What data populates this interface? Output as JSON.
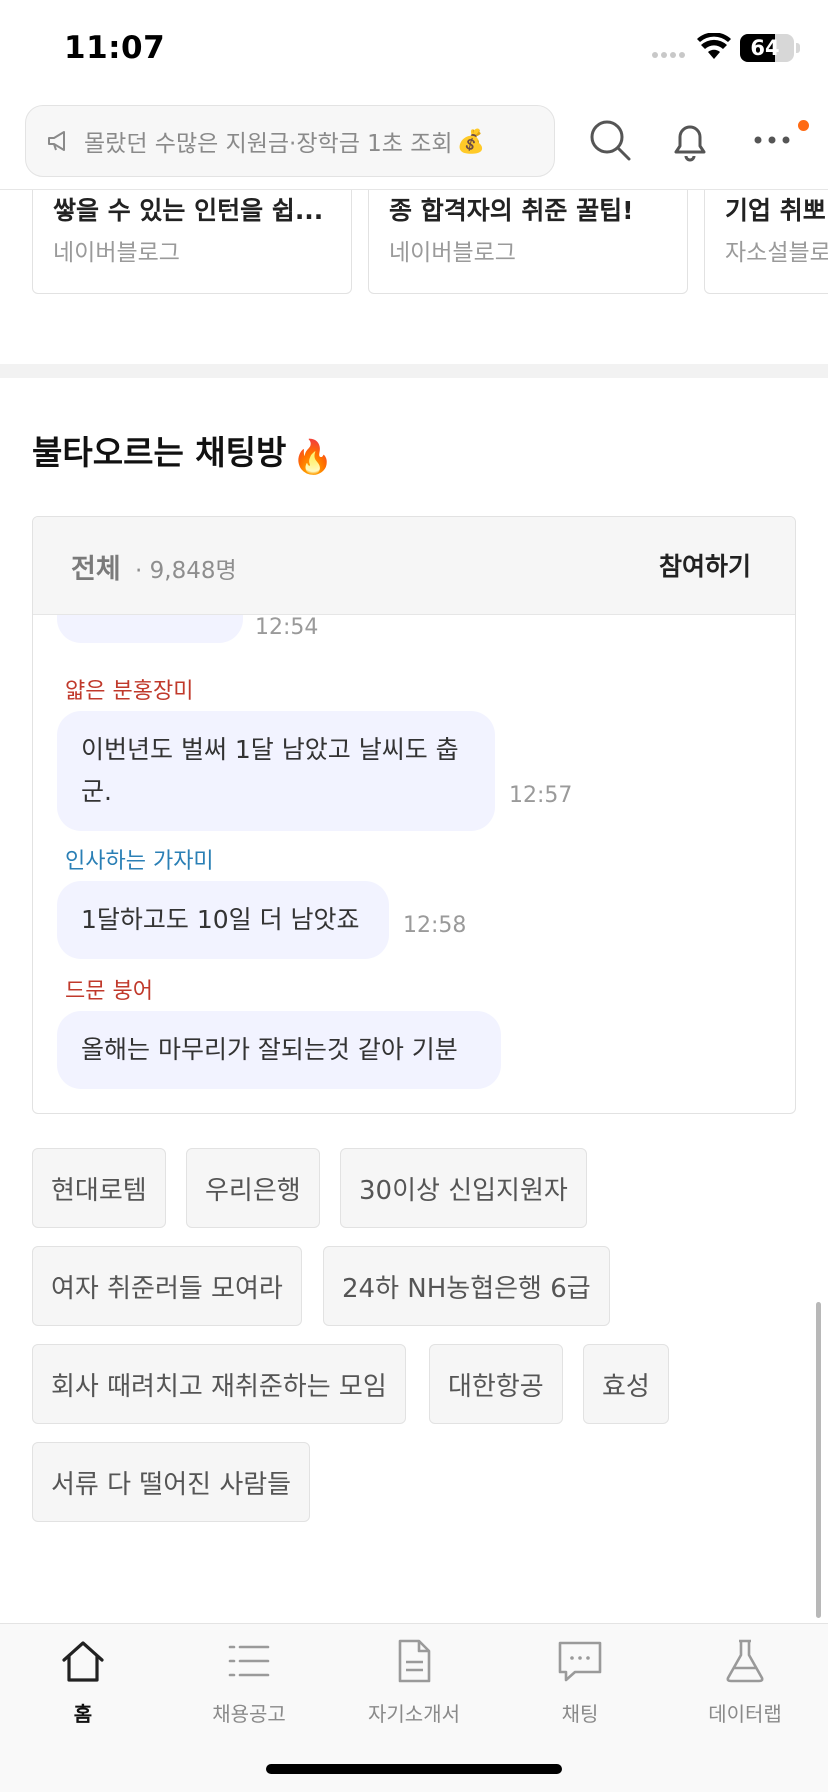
{
  "status": {
    "time": "11:07",
    "battery": "64",
    "battery_level": 0.64
  },
  "header": {
    "search_placeholder": "몰랐던 수많은 지원금·장학금 1초 조회",
    "search_emoji": "💰"
  },
  "blog_cards": [
    {
      "title": "쌓을 수 있는 인턴을 쉽...",
      "source": "네이버블로그"
    },
    {
      "title": "종 합격자의 취준 꿀팁!",
      "source": "네이버블로그"
    },
    {
      "title": "기업 취뽀",
      "source": "자소설블로"
    }
  ],
  "chat_section": {
    "title": "불타오르는 채팅방",
    "title_emoji": "🔥",
    "filter_label": "전체",
    "member_count": "· 9,848명",
    "join_label": "참여하기",
    "messages": [
      {
        "nickname": "",
        "text": "",
        "time": "12:54"
      },
      {
        "nickname": "얇은 분홍장미",
        "nickname_color": "#c0392b",
        "text": "이번년도 벌써 1달 남았고 날씨도 춥군.",
        "time": "12:57"
      },
      {
        "nickname": "인사하는 가자미",
        "nickname_color": "#2a7fb5",
        "text": "1달하고도 10일 더 남앗죠",
        "time": "12:58"
      },
      {
        "nickname": "드문 붕어",
        "nickname_color": "#c0392b",
        "text": "올해는 마무리가 잘되는것 같아 기분",
        "time": ""
      }
    ]
  },
  "tags": [
    "현대로템",
    "우리은행",
    "30이상 신입지원자",
    "여자 취준러들 모여라",
    "24하 NH농협은행 6급",
    "회사 때려치고 재취준하는 모임",
    "대한항공",
    "효성",
    "서류 다 떨어진 사람들"
  ],
  "bottom_nav": [
    {
      "label": "홈",
      "icon": "home-icon",
      "active": true
    },
    {
      "label": "채용공고",
      "icon": "list-icon",
      "active": false
    },
    {
      "label": "자기소개서",
      "icon": "document-icon",
      "active": false
    },
    {
      "label": "채팅",
      "icon": "chat-icon",
      "active": false
    },
    {
      "label": "데이터랩",
      "icon": "flask-icon",
      "active": false
    }
  ],
  "colors": {
    "accent_dot": "#ff6a13",
    "bubble_bg": "#f2f3ff"
  }
}
